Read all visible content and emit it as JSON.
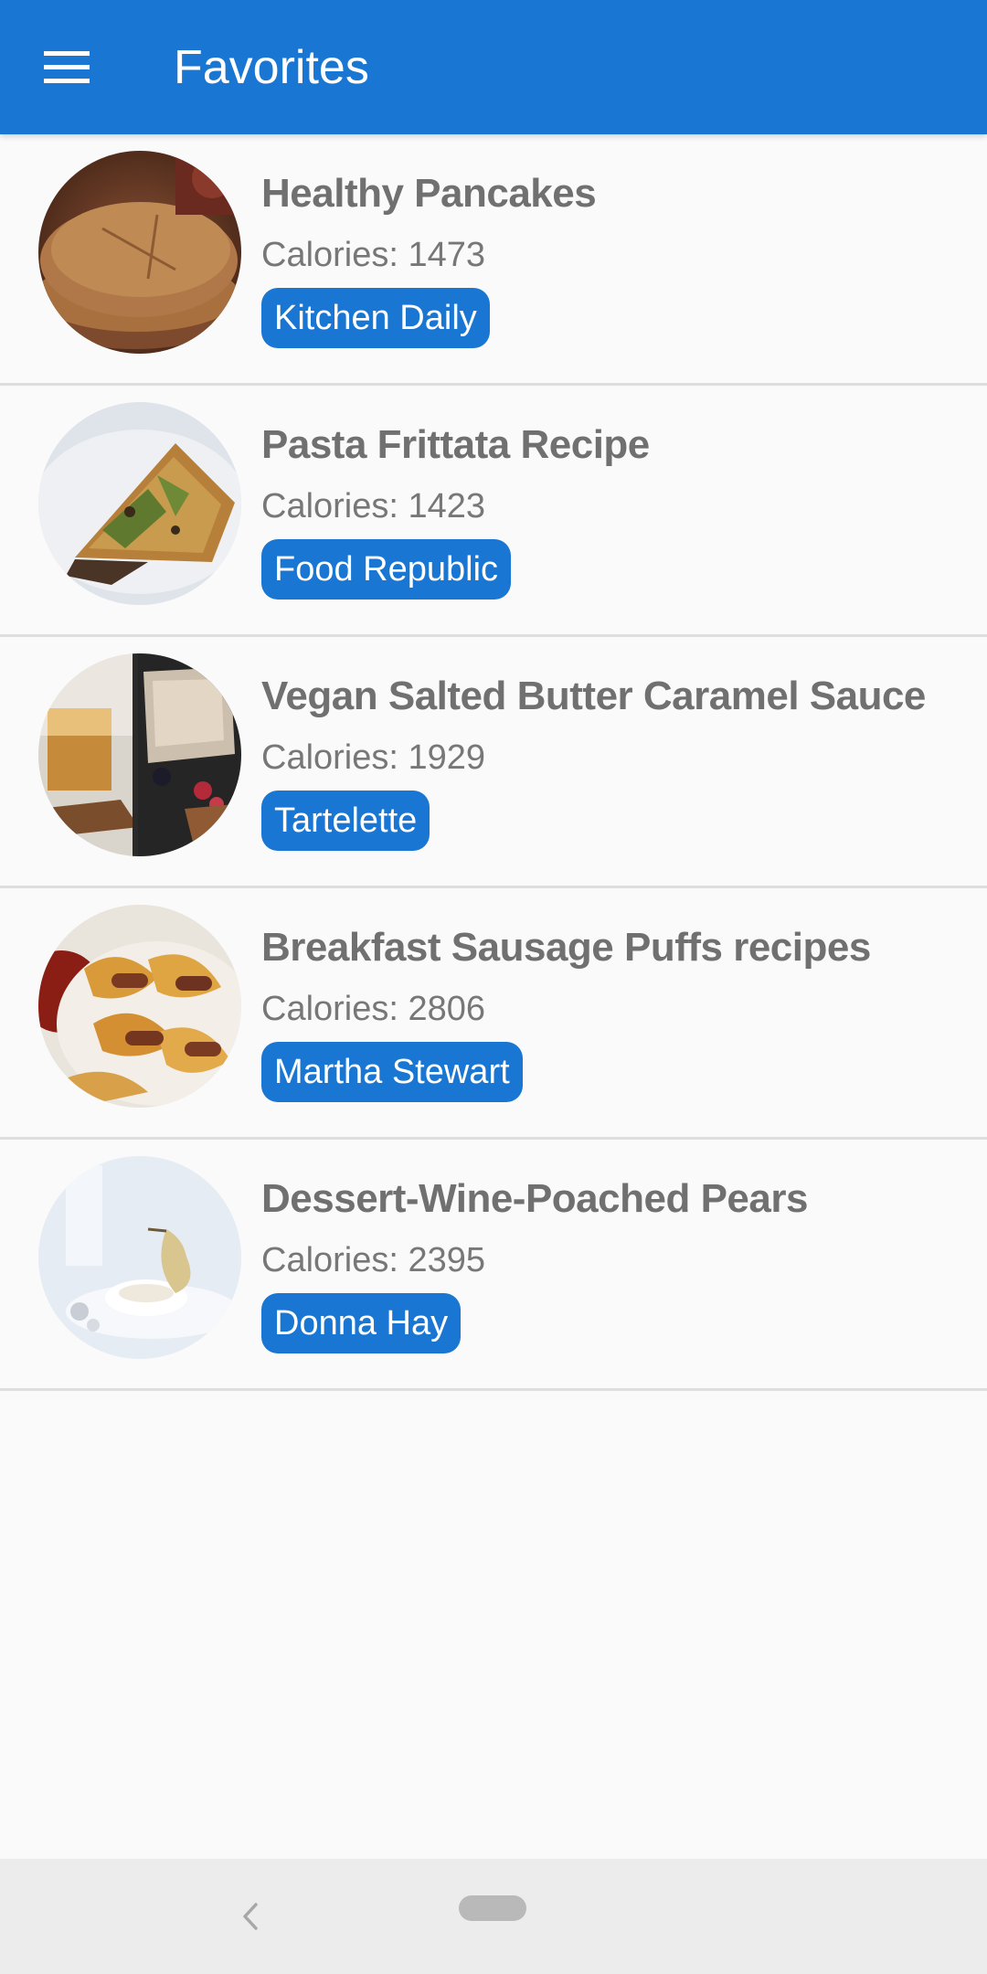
{
  "app_bar": {
    "title": "Favorites",
    "menu_icon": "hamburger-menu-icon",
    "color": "#1976d2"
  },
  "recipes": [
    {
      "title": "Healthy Pancakes",
      "calories": "Calories: 1473",
      "source": "Kitchen Daily",
      "image": "pancakes-photo"
    },
    {
      "title": "Pasta Frittata Recipe",
      "calories": "Calories: 1423",
      "source": "Food Republic",
      "image": "frittata-photo"
    },
    {
      "title": "Vegan Salted Butter Caramel Sauce",
      "calories": "Calories: 1929",
      "source": "Tartelette",
      "image": "caramel-sauce-photo"
    },
    {
      "title": "Breakfast Sausage Puffs recipes",
      "calories": "Calories: 2806",
      "source": "Martha Stewart",
      "image": "sausage-puffs-photo"
    },
    {
      "title": "Dessert-Wine-Poached Pears",
      "calories": "Calories: 2395",
      "source": "Donna Hay",
      "image": "poached-pears-photo"
    }
  ],
  "system_nav": {
    "back_icon": "back-chevron-icon",
    "home_icon": "home-pill-icon"
  }
}
